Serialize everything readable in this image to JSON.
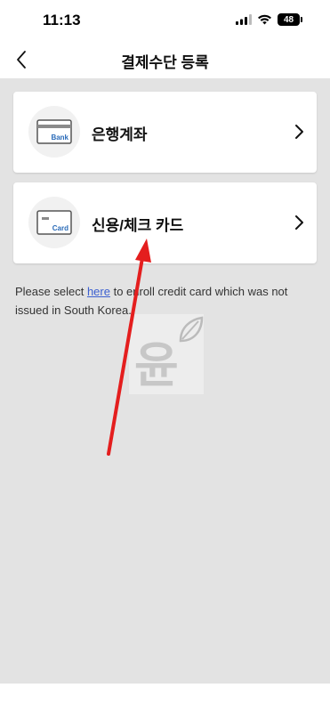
{
  "status_bar": {
    "time": "11:13",
    "battery": "48"
  },
  "header": {
    "title": "결제수단 등록",
    "back_icon": "chevron-left-icon"
  },
  "payment_methods": [
    {
      "label": "은행계좌",
      "icon_text": "Bank",
      "icon": "bank-card-icon"
    },
    {
      "label": "신용/체크 카드",
      "icon_text": "Card",
      "icon": "credit-card-icon"
    }
  ],
  "note": {
    "prefix": "Please select ",
    "link_text": "here",
    "suffix": " to enroll credit card which was not issued in South Korea."
  },
  "watermark": {
    "text": "윤"
  },
  "colors": {
    "background": "#e3e3e3",
    "link": "#3b5fd0",
    "card_icon_accent": "#2a6bb8",
    "annotation_arrow": "#e41e1e"
  }
}
